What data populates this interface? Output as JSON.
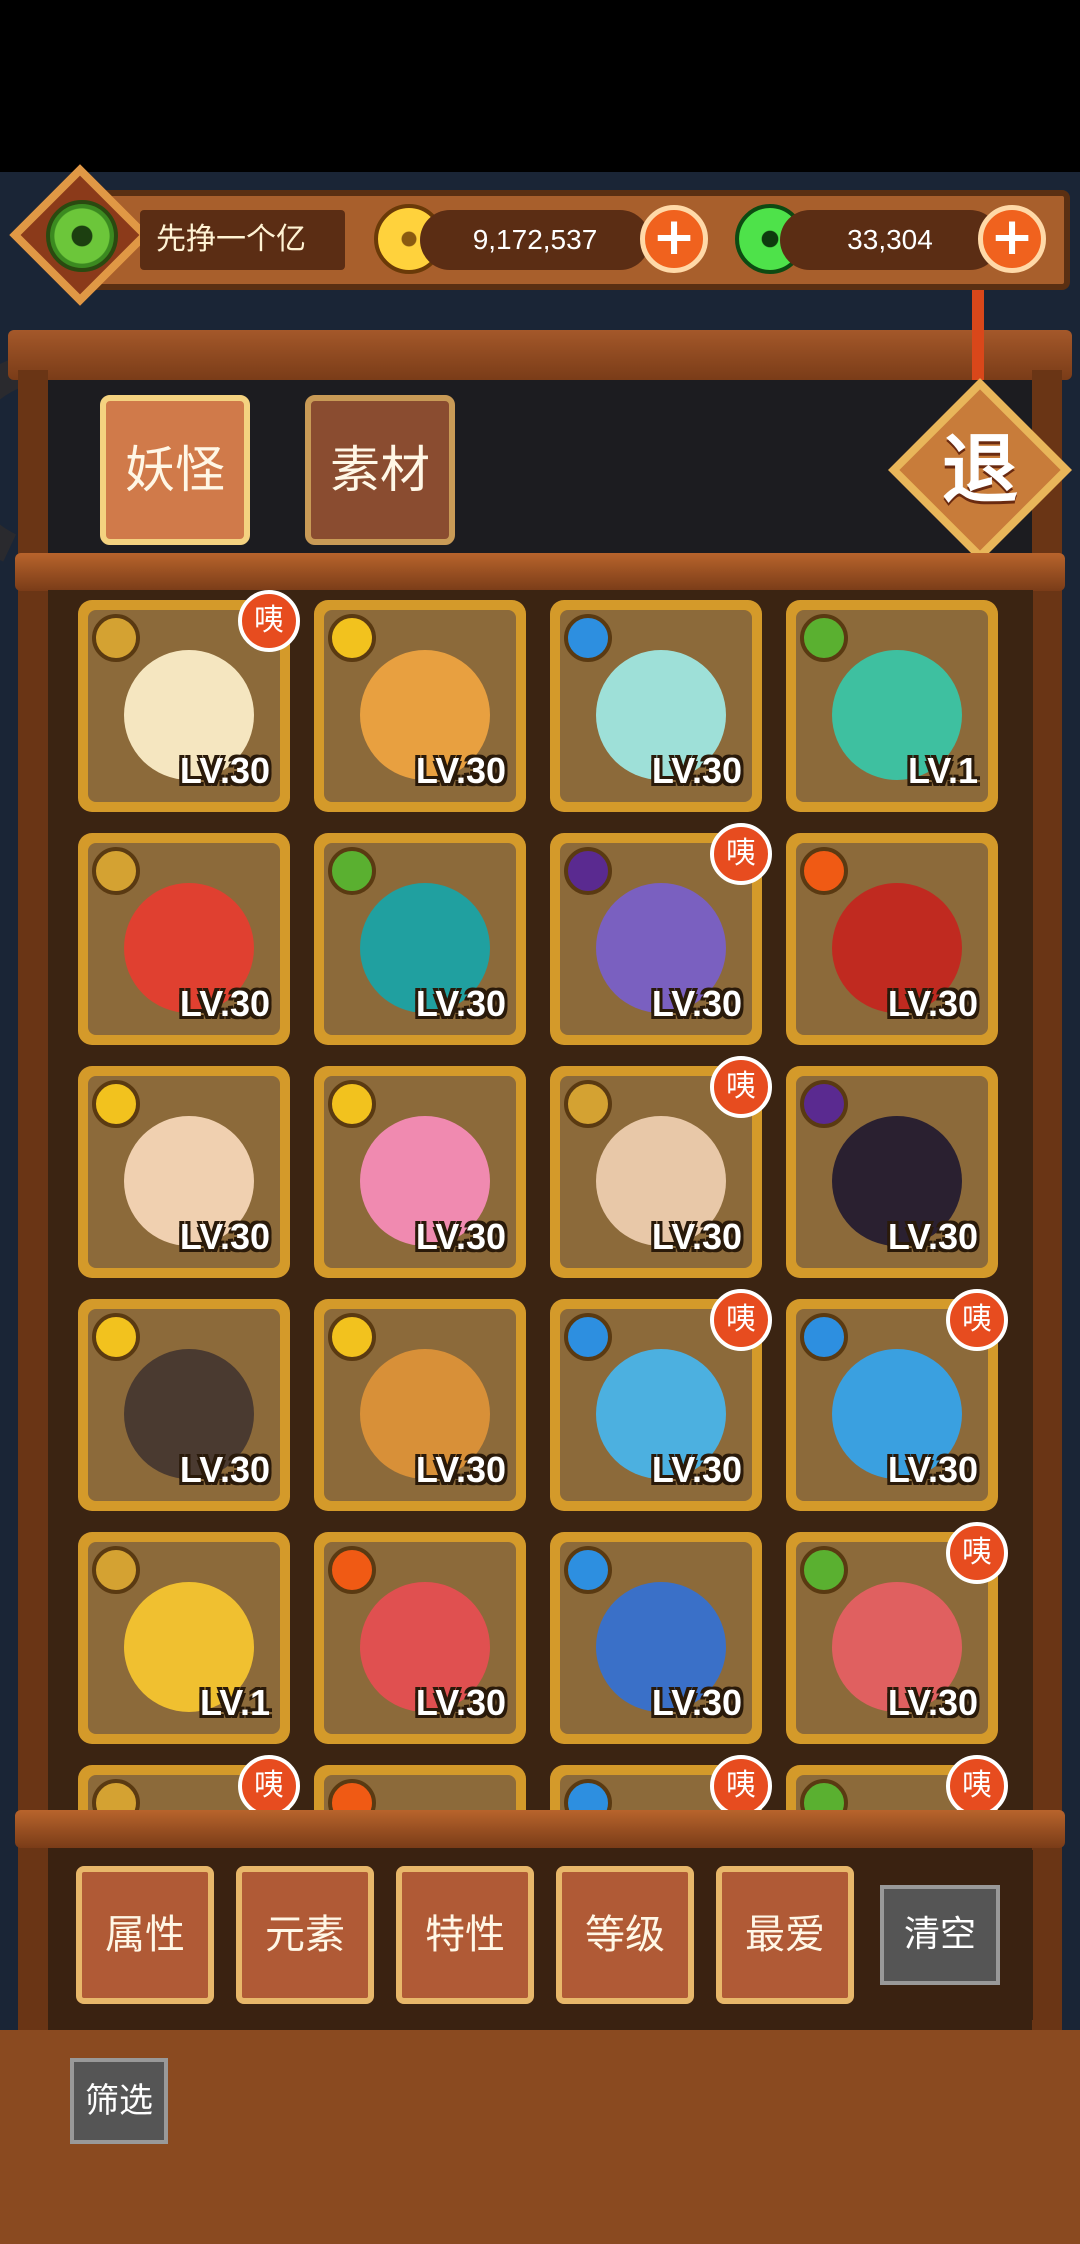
{
  "header": {
    "player_name": "先挣一个亿",
    "coins": "9,172,537",
    "gems": "33,304"
  },
  "tabs": [
    {
      "label": "妖怪",
      "active": true
    },
    {
      "label": "素材",
      "active": false
    }
  ],
  "exit_label": "退",
  "colors": {
    "card_border": "#d49a2a",
    "badge": "#e74c1f",
    "plus": "#f0621e",
    "element_earth": "#d4a232",
    "element_sun": "#f2c21e",
    "element_water": "#2d8fe0",
    "element_wood": "#5ab030",
    "element_fire": "#f05a14",
    "element_dark": "#5a2a90"
  },
  "monsters": [
    {
      "element": "earth",
      "level": "LV.30",
      "badge": "咦",
      "tint": "#f5e6c0"
    },
    {
      "element": "sun",
      "level": "LV.30",
      "badge": "",
      "tint": "#e8a040"
    },
    {
      "element": "water",
      "level": "LV.30",
      "badge": "",
      "tint": "#9ee0d8"
    },
    {
      "element": "wood",
      "level": "LV.1",
      "badge": "",
      "tint": "#3ec0a0"
    },
    {
      "element": "earth",
      "level": "LV.30",
      "badge": "",
      "tint": "#e04030"
    },
    {
      "element": "wood",
      "level": "LV.30",
      "badge": "",
      "tint": "#20a0a0"
    },
    {
      "element": "dark",
      "level": "LV.30",
      "badge": "咦",
      "tint": "#7a60c0"
    },
    {
      "element": "fire",
      "level": "LV.30",
      "badge": "",
      "tint": "#c02a20"
    },
    {
      "element": "sun",
      "level": "LV.30",
      "badge": "",
      "tint": "#f0d0b0"
    },
    {
      "element": "sun",
      "level": "LV.30",
      "badge": "",
      "tint": "#f08ab0"
    },
    {
      "element": "earth",
      "level": "LV.30",
      "badge": "咦",
      "tint": "#e8c8a8"
    },
    {
      "element": "dark",
      "level": "LV.30",
      "badge": "",
      "tint": "#2a2030"
    },
    {
      "element": "sun",
      "level": "LV.30",
      "badge": "",
      "tint": "#4a3a30"
    },
    {
      "element": "sun",
      "level": "LV.30",
      "badge": "",
      "tint": "#d89038"
    },
    {
      "element": "water",
      "level": "LV.30",
      "badge": "咦",
      "tint": "#4cb0e0"
    },
    {
      "element": "water",
      "level": "LV.30",
      "badge": "咦",
      "tint": "#3aa0e0"
    },
    {
      "element": "earth",
      "level": "LV.1",
      "badge": "",
      "tint": "#f0c030"
    },
    {
      "element": "fire",
      "level": "LV.30",
      "badge": "",
      "tint": "#e05050"
    },
    {
      "element": "water",
      "level": "LV.30",
      "badge": "",
      "tint": "#3a70c8"
    },
    {
      "element": "wood",
      "level": "LV.30",
      "badge": "咦",
      "tint": "#e06060"
    },
    {
      "element": "earth",
      "level": "",
      "badge": "咦",
      "tint": "#8c6a3a"
    },
    {
      "element": "fire",
      "level": "",
      "badge": "",
      "tint": "#8c6a3a"
    },
    {
      "element": "water",
      "level": "",
      "badge": "咦",
      "tint": "#8c6a3a"
    },
    {
      "element": "wood",
      "level": "",
      "badge": "咦",
      "tint": "#8c6a3a"
    }
  ],
  "filters": [
    "属性",
    "元素",
    "特性",
    "等级",
    "最爱"
  ],
  "clear_label": "清空",
  "screen_label": "筛选"
}
